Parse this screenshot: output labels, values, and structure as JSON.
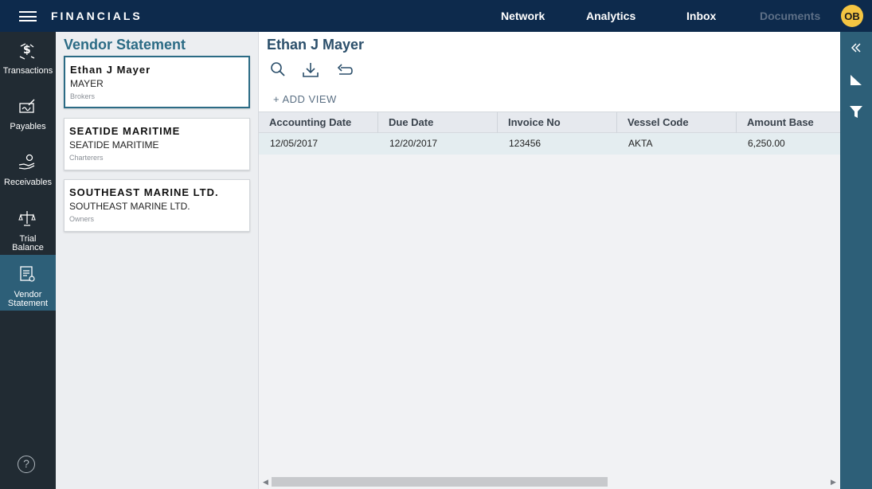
{
  "header": {
    "app_title": "FINANCIALS",
    "nav": [
      "Network",
      "Analytics",
      "Inbox",
      "Documents"
    ],
    "avatar_initials": "OB"
  },
  "sidebar": {
    "items": [
      {
        "label": "Transactions",
        "icon": "dollar-transfer-icon"
      },
      {
        "label": "Payables",
        "icon": "signature-pen-icon"
      },
      {
        "label": "Receivables",
        "icon": "hand-coins-icon"
      },
      {
        "label_line1": "Trial",
        "label_line2": "Balance",
        "icon": "scale-icon"
      },
      {
        "label_line1": "Vendor",
        "label_line2": "Statement",
        "icon": "statement-icon"
      }
    ],
    "help_label": "?"
  },
  "vendor_panel": {
    "title": "Vendor Statement",
    "vendors": [
      {
        "name": "Ethan J Mayer",
        "short": "MAYER",
        "type": "Brokers"
      },
      {
        "name": "SEATIDE MARITIME",
        "short": "SEATIDE MARITIME",
        "type": "Charterers"
      },
      {
        "name": "SOUTHEAST MARINE LTD.",
        "short": "SOUTHEAST MARINE LTD.",
        "type": "Owners"
      }
    ]
  },
  "main": {
    "title": "Ethan J Mayer",
    "add_view": "+ ADD VIEW",
    "columns": [
      "Accounting Date",
      "Due Date",
      "Invoice No",
      "Vessel Code",
      "Amount Base"
    ],
    "rows": [
      [
        "12/05/2017",
        "12/20/2017",
        "123456",
        "AKTA",
        "6,250.00"
      ]
    ]
  },
  "colors": {
    "topbar": "#0d2a4c",
    "sidebar": "#212b33",
    "accent": "#2d5f78",
    "title_teal": "#2b6b85",
    "avatar": "#f4c542"
  }
}
